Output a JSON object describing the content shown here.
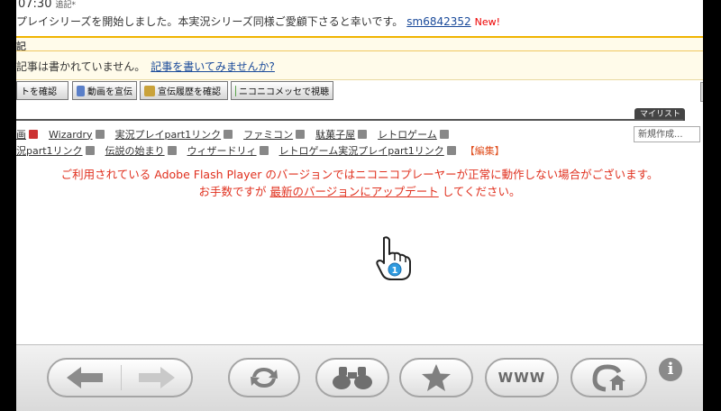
{
  "description": {
    "time": "07:30",
    "time_suffix": "追記*",
    "text": "プレイシリーズを開始しました。本実況シリーズ同様ご愛顧下さると幸いです。",
    "link": "sm6842352",
    "new_badge": "New!"
  },
  "article": {
    "heading": "記",
    "message": "記事は書かれていません。",
    "write_link": "記事を書いてみませんか?"
  },
  "buttons": [
    {
      "label": "トを確認"
    },
    {
      "label": "動画を宣伝"
    },
    {
      "label": "宣伝履歴を確認"
    },
    {
      "label": "ニコニコメッセで視聴"
    }
  ],
  "mylist": {
    "tab_label": "マイリスト",
    "select_value": "新規作成..."
  },
  "tags": {
    "row1": [
      "画",
      "Wizardry",
      "実況プレイpart1リンク",
      "ファミコン",
      "駄菓子屋",
      "レトロゲーム"
    ],
    "row2": [
      "況part1リンク",
      "伝説の始まり",
      "ウィザードリィ",
      "レトロゲーム実況プレイpart1リンク"
    ],
    "edit_label": "【編集】"
  },
  "notice": {
    "line1": "ご利用されている Adobe Flash Player のバージョンではニコニコプレーヤーが正常に動作しない場合がございます。",
    "line2_prefix": "お手数ですが",
    "line2_link": "最新のバージョンにアップデート",
    "line2_suffix": "してください。"
  },
  "cursor": {
    "player_number": "1"
  },
  "toolbar": {
    "www_label": "WWW",
    "info_label": "i"
  },
  "colors": {
    "notice": "#e0301e",
    "link": "#1a4a9a",
    "article_border": "#f0b400",
    "cursor_badge": "#2f9be0"
  }
}
